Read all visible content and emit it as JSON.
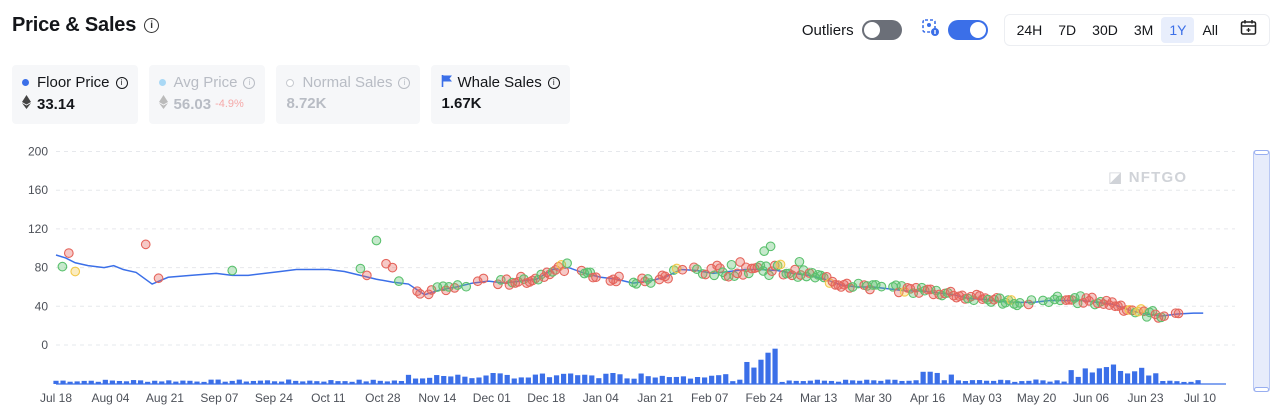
{
  "header": {
    "title": "Price & Sales",
    "info": "i"
  },
  "controls": {
    "outliers_label": "Outliers",
    "outliers_enabled": false,
    "compare_enabled": true,
    "ranges": [
      "24H",
      "7D",
      "30D",
      "3M",
      "1Y",
      "All"
    ],
    "active_range": "1Y"
  },
  "cards": [
    {
      "label": "Floor Price",
      "value": "33.14",
      "dot_color": "#3b6fe8",
      "faded": false,
      "eth": true
    },
    {
      "label": "Avg Price",
      "value": "56.03",
      "change": "-4.9%",
      "dot_color": "#a9d8f5",
      "faded": true,
      "eth": true
    },
    {
      "label": "Normal Sales",
      "value": "8.72K",
      "dot_color": "#c7cad0",
      "faded": true,
      "eth": false
    },
    {
      "label": "Whale Sales",
      "value": "1.67K",
      "flag_color": "#3b6fe8",
      "faded": false,
      "eth": false
    }
  ],
  "watermark": "NFTGO",
  "colors": {
    "floor": "#3b6fe8",
    "volume": "#3b6fe8",
    "sale_high": "#e5655c",
    "sale_low": "#5bc16e",
    "sale_mid": "#f3c94b"
  },
  "chart_data": {
    "type": "line",
    "ylim": [
      0,
      200
    ],
    "yticks": [
      200,
      160,
      120,
      80,
      40,
      0
    ],
    "xticks": [
      "Jul 18",
      "Aug 04",
      "Aug 21",
      "Sep 07",
      "Sep 24",
      "Oct 11",
      "Oct 28",
      "Nov 14",
      "Dec 01",
      "Dec 18",
      "Jan 04",
      "Jan 21",
      "Feb 07",
      "Feb 24",
      "Mar 13",
      "Mar 30",
      "Apr 16",
      "May 03",
      "May 20",
      "Jun 06",
      "Jun 23",
      "Jul 10"
    ],
    "floor_series": {
      "name": "Floor Price",
      "x": [
        0,
        3,
        6,
        10,
        15,
        18,
        21,
        25,
        30,
        35,
        42,
        50,
        55,
        60,
        70,
        75,
        80,
        85,
        90,
        95,
        100,
        105,
        110,
        115,
        120,
        125,
        130,
        135,
        140,
        145,
        150,
        155,
        160,
        165,
        170,
        175,
        180,
        185,
        190,
        195,
        200,
        205,
        210,
        215,
        220,
        225,
        230,
        235,
        240,
        245,
        250,
        255,
        260,
        265,
        270,
        275,
        280,
        285,
        290,
        295,
        300,
        305,
        310,
        315,
        320,
        325,
        330,
        335,
        340,
        345,
        350,
        355,
        358
      ],
      "y": [
        93,
        90,
        85,
        82,
        80,
        82,
        78,
        75,
        63,
        70,
        72,
        74,
        72,
        72,
        76,
        78,
        78,
        78,
        76,
        72,
        68,
        65,
        63,
        52,
        57,
        60,
        64,
        66,
        64,
        66,
        68,
        78,
        80,
        74,
        70,
        68,
        64,
        66,
        70,
        78,
        77,
        74,
        76,
        78,
        78,
        77,
        74,
        72,
        68,
        62,
        60,
        60,
        58,
        56,
        56,
        54,
        52,
        48,
        47,
        45,
        44,
        44,
        46,
        46,
        46,
        44,
        42,
        36,
        32,
        30,
        32,
        33,
        33
      ]
    },
    "sales": {
      "x_scale": "days since Jul 18"
    },
    "volume": {
      "name": "Sales Volume"
    }
  }
}
